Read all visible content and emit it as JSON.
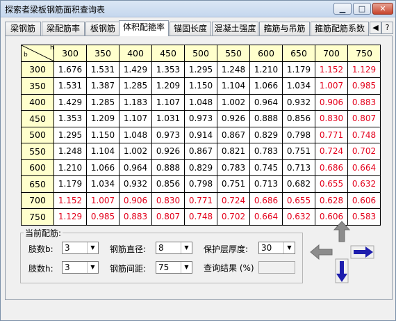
{
  "window": {
    "title": "探索者梁板钢筋面积查询表",
    "controls": {
      "minimize": "▁",
      "maximize": "□",
      "close": "✕"
    }
  },
  "tabs": [
    {
      "label": "梁钢筋"
    },
    {
      "label": "梁配筋率"
    },
    {
      "label": "板钢筋"
    },
    {
      "label": "体积配箍率",
      "active": true
    },
    {
      "label": "锚固长度"
    },
    {
      "label": "混凝土强度"
    },
    {
      "label": "箍筋与吊筋"
    },
    {
      "label": "箍筋配筋系数"
    }
  ],
  "table": {
    "corner_row_label": "b",
    "corner_col_label": "h",
    "columns": [
      "300",
      "350",
      "400",
      "450",
      "500",
      "550",
      "600",
      "650",
      "700",
      "750"
    ],
    "rows": [
      {
        "label": "300",
        "values": [
          "1.676",
          "1.531",
          "1.429",
          "1.353",
          "1.295",
          "1.248",
          "1.210",
          "1.179",
          "1.152",
          "1.129"
        ]
      },
      {
        "label": "350",
        "values": [
          "1.531",
          "1.387",
          "1.285",
          "1.209",
          "1.150",
          "1.104",
          "1.066",
          "1.034",
          "1.007",
          "0.985"
        ]
      },
      {
        "label": "400",
        "values": [
          "1.429",
          "1.285",
          "1.183",
          "1.107",
          "1.048",
          "1.002",
          "0.964",
          "0.932",
          "0.906",
          "0.883"
        ]
      },
      {
        "label": "450",
        "values": [
          "1.353",
          "1.209",
          "1.107",
          "1.031",
          "0.973",
          "0.926",
          "0.888",
          "0.856",
          "0.830",
          "0.807"
        ]
      },
      {
        "label": "500",
        "values": [
          "1.295",
          "1.150",
          "1.048",
          "0.973",
          "0.914",
          "0.867",
          "0.829",
          "0.798",
          "0.771",
          "0.748"
        ]
      },
      {
        "label": "550",
        "values": [
          "1.248",
          "1.104",
          "1.002",
          "0.926",
          "0.867",
          "0.821",
          "0.783",
          "0.751",
          "0.724",
          "0.702"
        ]
      },
      {
        "label": "600",
        "values": [
          "1.210",
          "1.066",
          "0.964",
          "0.888",
          "0.829",
          "0.783",
          "0.745",
          "0.713",
          "0.686",
          "0.664"
        ]
      },
      {
        "label": "650",
        "values": [
          "1.179",
          "1.034",
          "0.932",
          "0.856",
          "0.798",
          "0.751",
          "0.713",
          "0.682",
          "0.655",
          "0.632"
        ]
      },
      {
        "label": "700",
        "values": [
          "1.152",
          "1.007",
          "0.906",
          "0.830",
          "0.771",
          "0.724",
          "0.686",
          "0.655",
          "0.628",
          "0.606"
        ]
      },
      {
        "label": "750",
        "values": [
          "1.129",
          "0.985",
          "0.883",
          "0.807",
          "0.748",
          "0.702",
          "0.664",
          "0.632",
          "0.606",
          "0.583"
        ]
      }
    ],
    "highlight_color": "#e3001b",
    "header_bg": "#ffffcc"
  },
  "settings": {
    "group_title": "当前配筋:",
    "limbs_b": {
      "label": "肢数b:",
      "value": "3"
    },
    "limbs_h": {
      "label": "肢数h:",
      "value": "3"
    },
    "bar_diameter": {
      "label": "钢筋直径:",
      "value": "8"
    },
    "bar_spacing": {
      "label": "钢筋间距:",
      "value": "75"
    },
    "cover": {
      "label": "保护层厚度:",
      "value": "30"
    },
    "result": {
      "label": "查询结果 (%)",
      "value": ""
    }
  },
  "icons": {
    "tab_scroll_left": "◀",
    "tab_scroll_right": "?"
  }
}
